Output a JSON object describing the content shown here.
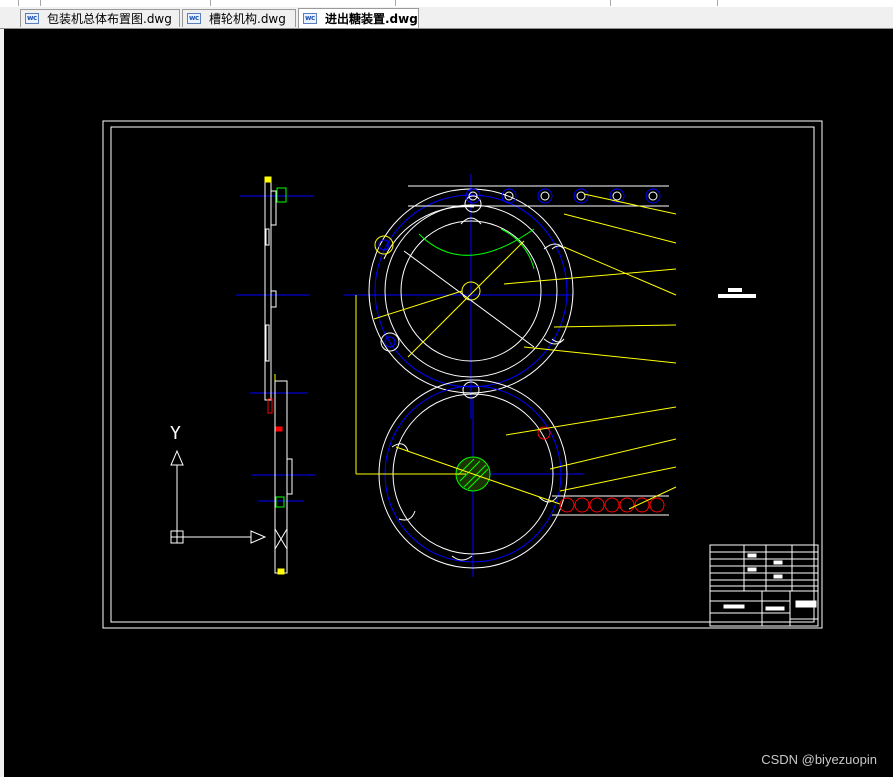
{
  "tabs": [
    {
      "label": "包装机总体布置图.dwg",
      "active": false
    },
    {
      "label": "槽轮机构.dwg",
      "active": false
    },
    {
      "label": "进出糖装置.dwg",
      "active": true
    }
  ],
  "tab_icon": "dwg-file-icon",
  "ucs": {
    "y_label": "Y"
  },
  "colors": {
    "canvas": "#000000",
    "frame": "#ffffff",
    "centerline": "#0000ff",
    "leader": "#ffff00",
    "section": "#00ff00",
    "accent": "#ff0000"
  },
  "watermark": "CSDN @biyezuopin"
}
